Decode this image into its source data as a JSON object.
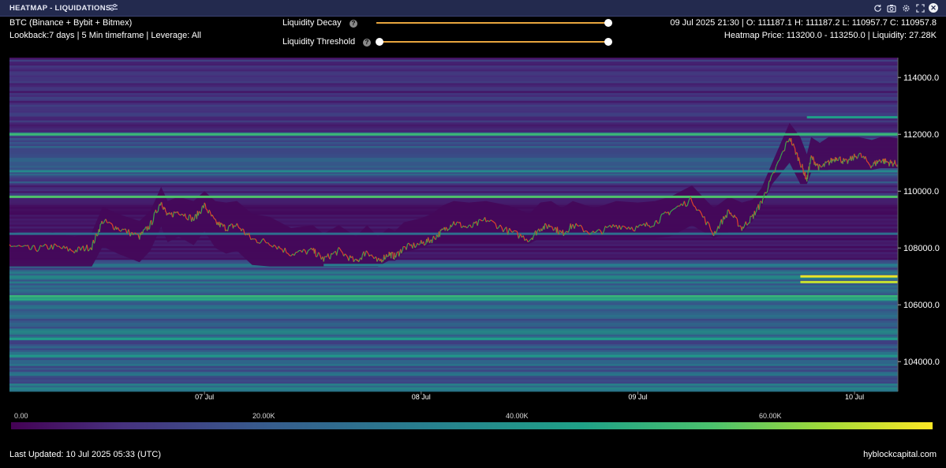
{
  "window": {
    "title": "HEATMAP - LIQUIDATIONS",
    "icons": [
      "refresh-icon",
      "camera-icon",
      "settings-icon",
      "expand-icon",
      "close-icon"
    ]
  },
  "header": {
    "pair": "BTC (Binance + Bybit + Bitmex)",
    "lookback": "Lookback:7 days | 5 Min timeframe | Leverage: All",
    "ohlc": "09 Jul 2025 21:30 | O: 111187.1 H: 111187.2 L: 110957.7 C: 110957.8",
    "heatmap_info": "Heatmap Price: 113200.0 - 113250.0 | Liquidity: 27.28K"
  },
  "controls": {
    "decay_label": "Liquidity Decay",
    "threshold_label": "Liquidity Threshold",
    "decay_value": 1.0,
    "threshold_value": 0.0,
    "accent_color": "#e7a53d"
  },
  "chart_data": {
    "type": "heatmap",
    "title": "",
    "x_tick_labels": [
      "07 Jul",
      "08 Jul",
      "09 Jul",
      "10 Jul"
    ],
    "y_tick_labels": [
      "114000.0",
      "112000.0",
      "110000.0",
      "108000.0",
      "106000.0",
      "104000.0"
    ],
    "y_ticks": [
      114000,
      112000,
      110000,
      108000,
      106000,
      104000
    ],
    "ylim": [
      102950,
      114700
    ],
    "x_range_days": [
      6.1,
      10.2
    ],
    "colorscale": [
      "#440154",
      "#46317e",
      "#365c8d",
      "#277f8e",
      "#1fa187",
      "#4ac16d",
      "#9fda3a",
      "#fde725"
    ],
    "colorbar_ticks": [
      "0.00",
      "20.00K",
      "40.00K",
      "60.00K"
    ],
    "colorbar_range": [
      0,
      72000
    ],
    "price_series": {
      "name": "BTC",
      "x_days": [
        6.1,
        6.2,
        6.3,
        6.4,
        6.48,
        6.53,
        6.6,
        6.7,
        6.75,
        6.8,
        6.83,
        6.88,
        6.95,
        7.0,
        7.05,
        7.1,
        7.15,
        7.22,
        7.3,
        7.4,
        7.5,
        7.55,
        7.62,
        7.7,
        7.75,
        7.8,
        7.85,
        7.88,
        7.92,
        8.0,
        8.05,
        8.1,
        8.15,
        8.22,
        8.3,
        8.4,
        8.5,
        8.55,
        8.6,
        8.65,
        8.7,
        8.8,
        8.9,
        9.0,
        9.08,
        9.15,
        9.25,
        9.35,
        9.42,
        9.48,
        9.53,
        9.57,
        9.62,
        9.7,
        9.75,
        9.78,
        9.8,
        9.84,
        9.88,
        9.92,
        9.96,
        10.02,
        10.08,
        10.12,
        10.16,
        10.2
      ],
      "y": [
        108100,
        107950,
        108050,
        107900,
        108050,
        108950,
        108700,
        108400,
        108800,
        109650,
        109100,
        109300,
        109000,
        109500,
        108900,
        108700,
        108800,
        108300,
        108200,
        107800,
        107900,
        107600,
        107900,
        107500,
        107900,
        107500,
        107800,
        107700,
        108000,
        108150,
        108300,
        108600,
        108900,
        108700,
        109000,
        108600,
        108300,
        108700,
        108800,
        108500,
        108800,
        108500,
        108800,
        108700,
        108900,
        109300,
        109700,
        108500,
        109300,
        108700,
        109100,
        109600,
        110500,
        111900,
        111000,
        110400,
        111200,
        110800,
        111000,
        111200,
        111000,
        111300,
        110900,
        111100,
        111000,
        110958
      ]
    },
    "liquidity_bands": [
      {
        "price": 112000,
        "start_day": 6.1,
        "value": 48000
      },
      {
        "price": 109800,
        "start_day": 6.1,
        "value": 52000
      },
      {
        "price": 107400,
        "start_day": 7.55,
        "value": 30000
      },
      {
        "price": 107000,
        "start_day": 9.75,
        "value": 70000
      },
      {
        "price": 106800,
        "start_day": 9.75,
        "value": 66000
      },
      {
        "price": 106300,
        "start_day": 6.1,
        "value": 47000
      },
      {
        "price": 106200,
        "start_day": 6.1,
        "value": 44000
      },
      {
        "price": 104800,
        "start_day": 6.1,
        "value": 40000
      },
      {
        "price": 104200,
        "start_day": 6.1,
        "value": 38000
      },
      {
        "price": 112600,
        "start_day": 9.78,
        "value": 40000
      },
      {
        "price": 110700,
        "start_day": 6.1,
        "value": 34000
      },
      {
        "price": 108500,
        "start_day": 6.1,
        "value": 26000
      }
    ]
  },
  "footer": {
    "last_updated": "Last Updated: 10 Jul 2025 05:33 (UTC)",
    "brand": "hyblockcapital.com"
  }
}
